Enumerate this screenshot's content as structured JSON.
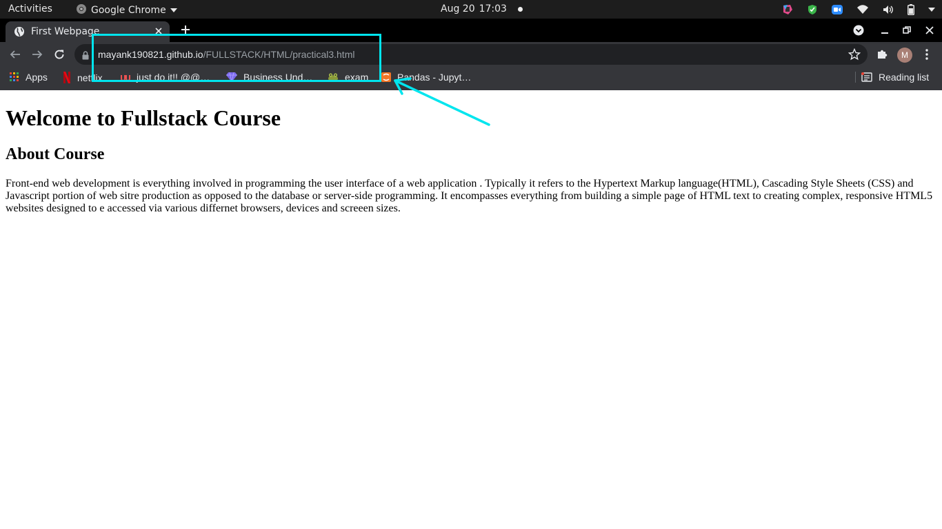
{
  "system_bar": {
    "activities": "Activities",
    "app_name": "Google Chrome",
    "date": "Aug 20",
    "time": "17:03"
  },
  "browser": {
    "tab": {
      "title": "First Webpage"
    },
    "address": {
      "host": "mayank190821.github.io",
      "path": "/FULLSTACK/HTML/practical3.html"
    },
    "profile_initial": "M",
    "bookmarks": [
      {
        "label": "Apps",
        "icon": "apps-grid-icon"
      },
      {
        "label": "netflix",
        "icon": "netflix-icon"
      },
      {
        "label": "just do it!! @@…",
        "icon": "udemy-icon"
      },
      {
        "label": "Business Und…",
        "icon": "gem-icon"
      },
      {
        "label": "exam",
        "icon": "frog-icon"
      },
      {
        "label": "Pandas - Jupyt…",
        "icon": "jupyter-icon"
      }
    ],
    "reading_list": "Reading list"
  },
  "page": {
    "heading": "Welcome to Fullstack Course",
    "subheading": "About Course",
    "paragraph": "Front-end web development is everything involved in programming the user interface of a web application . Typically it refers to the Hypertext Markup language(HTML), Cascading Style Sheets (CSS) and Javascript portion of web sitre production as opposed to the database or server-side programming. It encompasses everything from building a simple page of HTML text to creating complex, responsive HTML5 websites designed to e accessed via various differnet browsers, devices and screeen sizes."
  },
  "colors": {
    "annotation": "#00e5ee",
    "tab_strip": "#000000",
    "toolbar": "#35363a",
    "omnibox": "#202124"
  }
}
